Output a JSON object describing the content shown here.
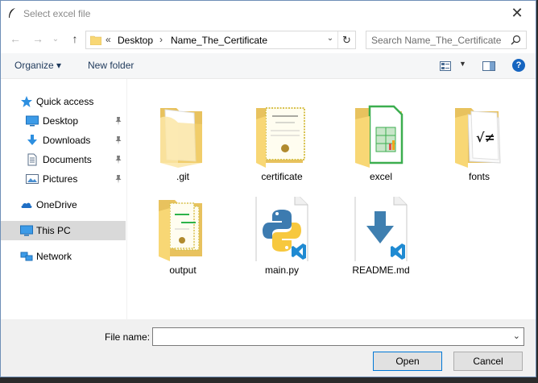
{
  "window": {
    "title": "Select excel file"
  },
  "nav": {
    "back": "←",
    "forward": "→",
    "recent": "⌄",
    "up": "↑"
  },
  "address": {
    "overflow": "«",
    "crumbs": [
      "Desktop",
      "Name_The_Certificate"
    ],
    "separator": "›"
  },
  "search": {
    "placeholder": "Search Name_The_Certificate"
  },
  "toolbar": {
    "organize": "Organize ▾",
    "new_folder": "New folder",
    "help": "?"
  },
  "sidebar": {
    "items": [
      {
        "label": "Quick access",
        "icon": "star-icon"
      },
      {
        "label": "Desktop",
        "icon": "desktop-icon",
        "pinned": true
      },
      {
        "label": "Downloads",
        "icon": "download-icon",
        "pinned": true
      },
      {
        "label": "Documents",
        "icon": "documents-icon",
        "pinned": true
      },
      {
        "label": "Pictures",
        "icon": "pictures-icon",
        "pinned": true
      },
      {
        "label": "OneDrive",
        "icon": "onedrive-icon"
      },
      {
        "label": "This PC",
        "icon": "this-pc-icon",
        "selected": true
      },
      {
        "label": "Network",
        "icon": "network-icon"
      }
    ]
  },
  "files": [
    {
      "name": ".git",
      "icon": "folder-icon"
    },
    {
      "name": "certificate",
      "icon": "folder-certificate-icon"
    },
    {
      "name": "excel",
      "icon": "folder-excel-icon"
    },
    {
      "name": "fonts",
      "icon": "folder-fonts-icon"
    },
    {
      "name": "output",
      "icon": "folder-output-icon"
    },
    {
      "name": "main.py",
      "icon": "python-file-icon"
    },
    {
      "name": "README.md",
      "icon": "markdown-file-icon"
    }
  ],
  "bottom": {
    "file_name_label": "File name:",
    "file_name_value": "",
    "open_label": "Open",
    "cancel_label": "Cancel"
  },
  "colors": {
    "folder": "#f8d775",
    "selection": "#d9d9d9",
    "accent": "#0078d7",
    "python_blue": "#3c7bb0",
    "python_yellow": "#f7c83e",
    "vscode_blue": "#1f8ad2"
  }
}
